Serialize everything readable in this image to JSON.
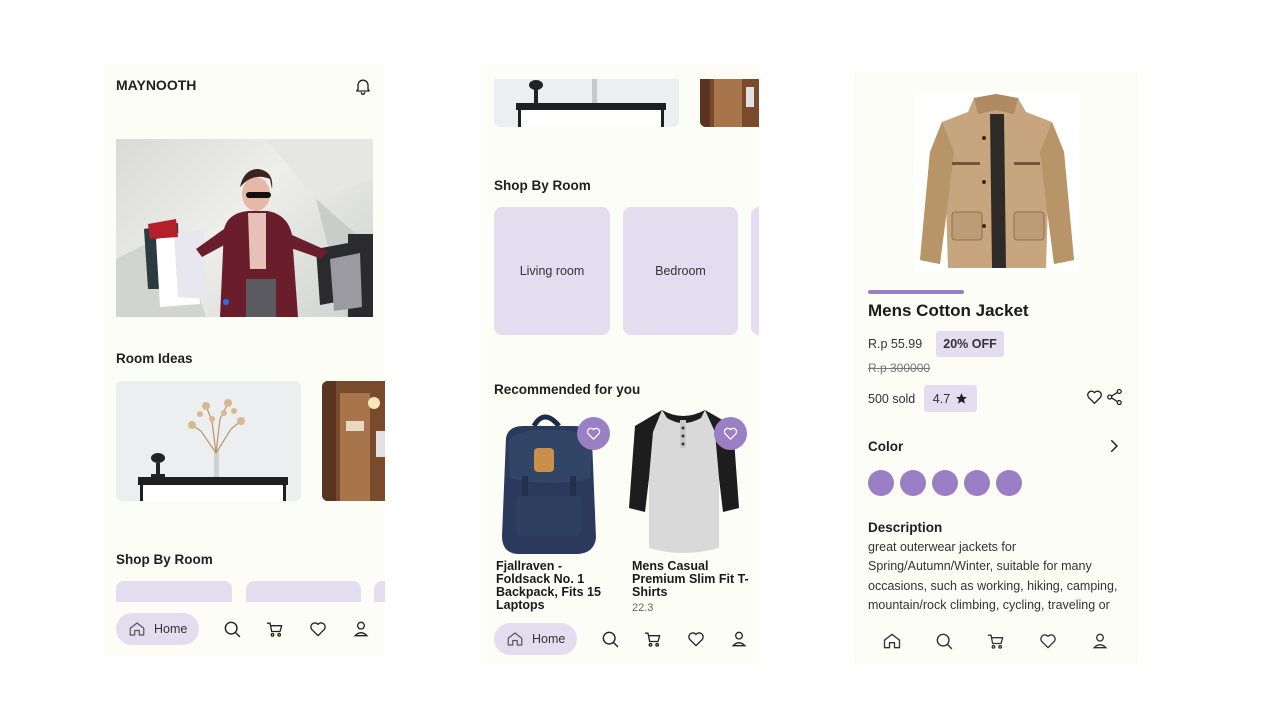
{
  "screen1": {
    "brand": "MAYNOOTH",
    "room_ideas_title": "Room Ideas",
    "shop_by_room_title": "Shop By Room",
    "nav": {
      "home_label": "Home"
    }
  },
  "screen2": {
    "shop_by_room_title": "Shop By Room",
    "rooms": [
      {
        "label": "Living room"
      },
      {
        "label": "Bedroom"
      }
    ],
    "recommended_title": "Recommended for you",
    "products": [
      {
        "name": "Fjallraven - Foldsack No. 1 Backpack, Fits 15 Laptops",
        "price": ""
      },
      {
        "name": "Mens Casual Premium Slim Fit T-Shirts",
        "price": "22.3"
      }
    ],
    "nav": {
      "home_label": "Home"
    }
  },
  "screen3": {
    "product_name": "Mens Cotton Jacket",
    "price": "R.p 55.99",
    "discount": "20% OFF",
    "original_price": "R.p 300000",
    "sold": "500 sold",
    "rating": "4.7",
    "color_title": "Color",
    "description_title": "Description",
    "description": "great outerwear jackets for Spring/Autumn/Winter, suitable for many occasions, such as working, hiking, camping, mountain/rock climbing, cycling, traveling or"
  },
  "colors": {
    "accent": "#9a7fc4",
    "lavender": "#e4ddef",
    "background": "#fdfdf7"
  }
}
